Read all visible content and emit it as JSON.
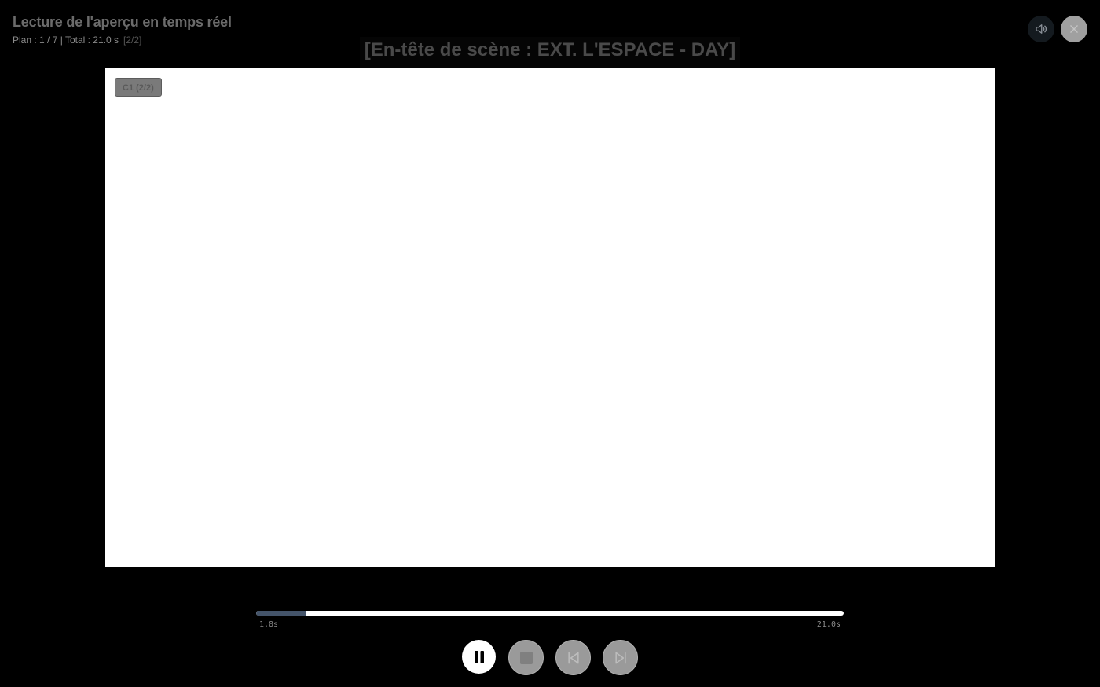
{
  "header": {
    "title": "Lecture de l'aperçu en temps réel",
    "meta": "Plan : 1 / 7 | Total : 21.0 s",
    "counter": "[2/2]"
  },
  "scene_heading": "[En-tête de scène : EXT. L'ESPACE - DAY]",
  "shot_badge": "C1 (2/2)",
  "timeline": {
    "current": "1.8s",
    "total": "21.0s",
    "progress": 0.086
  },
  "buttons": {
    "sound_icon": "speaker-icon",
    "close_icon": "close-icon",
    "play_pause_icon": "pause-icon",
    "stop_icon": "stop-icon",
    "previous_icon": "skip-previous-icon",
    "next_icon": "skip-next-icon"
  },
  "colors": {
    "background": "#000000",
    "frame": "#ffffff",
    "progress_fill": "#44546a",
    "progress_track": "#ffffff"
  }
}
